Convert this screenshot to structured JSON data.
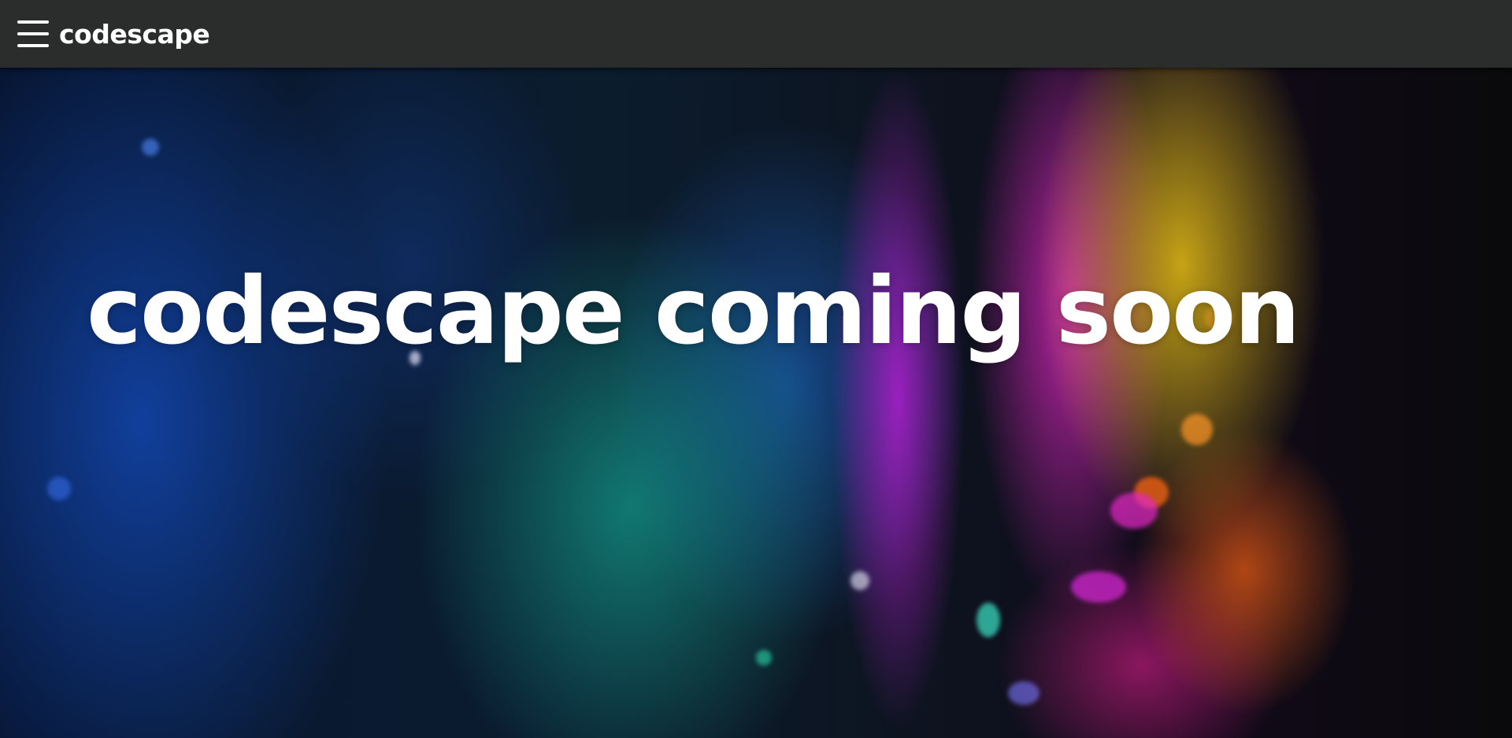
{
  "header": {
    "brand": "codescape"
  },
  "hero": {
    "title": "codescape coming soon"
  },
  "colors": {
    "topbar": "#2b2c2c",
    "text": "#ffffff"
  },
  "icons": {
    "menu": "hamburger-menu-icon"
  }
}
